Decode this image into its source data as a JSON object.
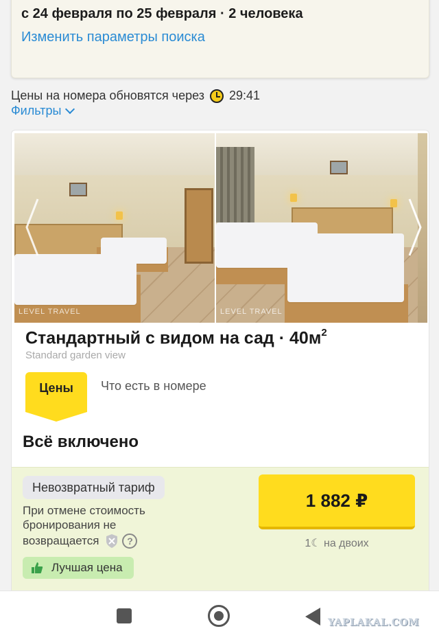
{
  "search": {
    "dates_text": "с 24 февраля по 25 февраля · 2 человека",
    "change_link": "Изменить параметры поиска"
  },
  "timer": {
    "text": "Цены на номера обновятся через",
    "value": "29:41",
    "icon": "clock-icon"
  },
  "filters": {
    "label": "Фильтры",
    "icon": "chevron-down-icon"
  },
  "room": {
    "title": "Стандартный с видом на сад · 40м",
    "title_sup": "2",
    "subtitle": "Standard garden view",
    "watermark": "LEVEL TRAVEL",
    "tabs": {
      "prices": "Цены",
      "in_room": "Что есть в номере"
    },
    "meal_plan": "Всё включено"
  },
  "rate": {
    "tariff": "Невозвратный тариф",
    "cancel_note": "При отмене стоимость бронирования не",
    "cancel_note_last": "возвращается",
    "help": "?",
    "best_price": "Лучшая цена",
    "price": "1 882 ₽",
    "guests": "1☾ на двоих",
    "accent": "#ffdc1e",
    "best_bg": "#c8ecb0"
  },
  "navbar": {
    "watermark_logo": "YAPLAKAL.COM"
  }
}
